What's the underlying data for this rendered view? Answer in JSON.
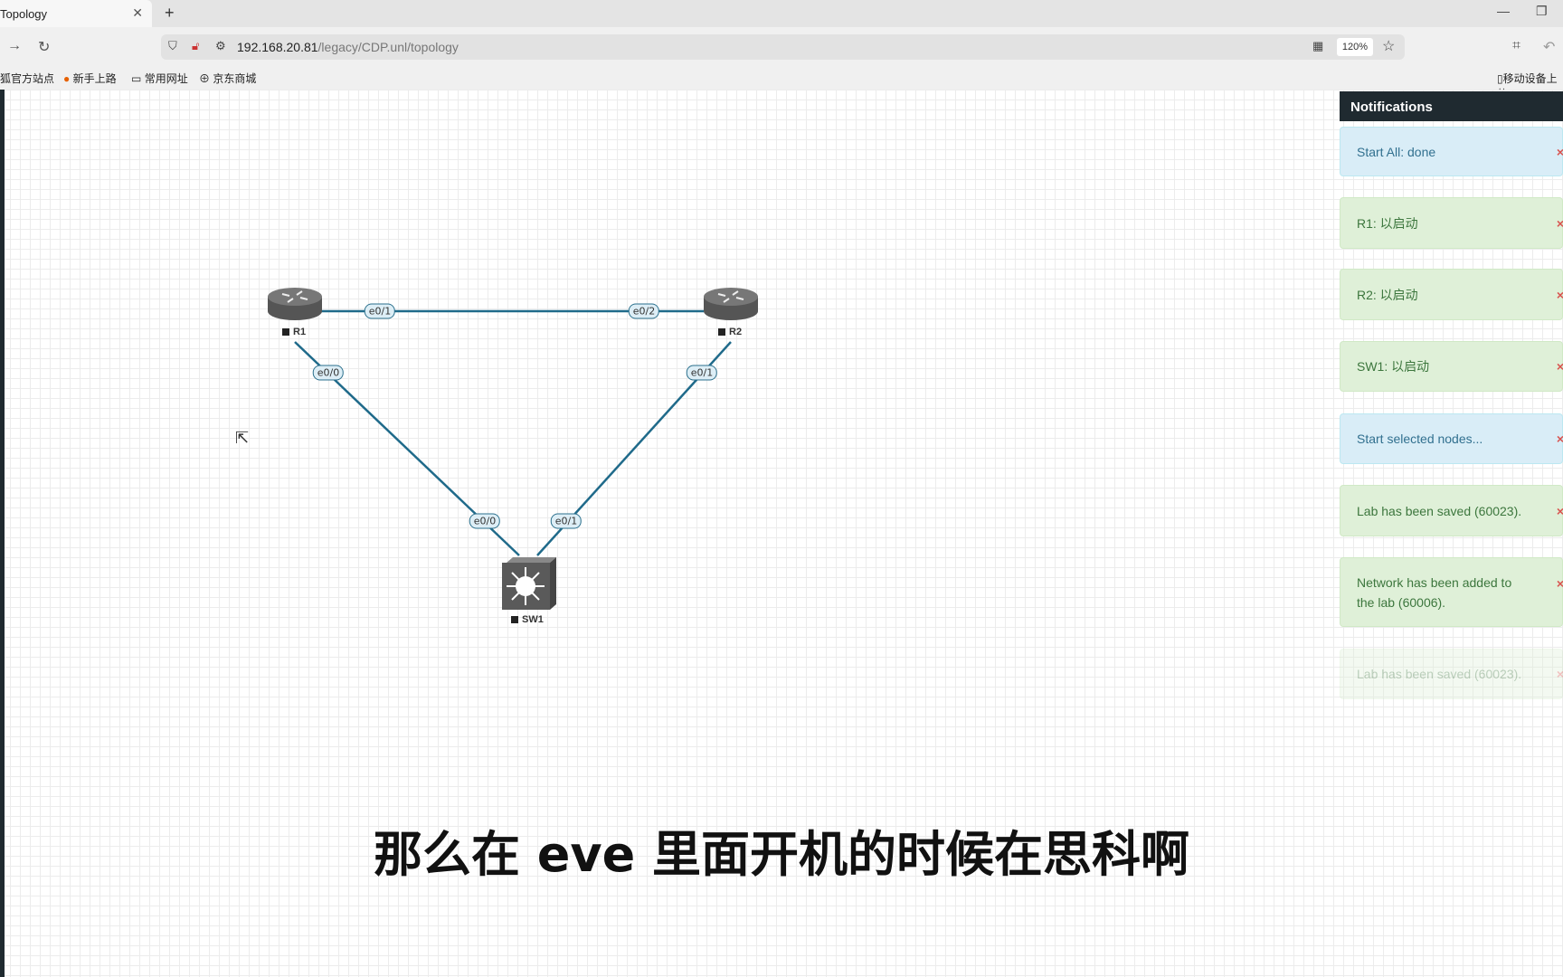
{
  "browser": {
    "tab_title": "Topology",
    "url_host": "192.168.20.81",
    "url_path": "/legacy/CDP.unl/topology",
    "zoom": "120%",
    "bookmarks": [
      "狐官方站点",
      "新手上路",
      "常用网址",
      "京东商城"
    ],
    "mobile_bookmark": "移动设备上的"
  },
  "topology": {
    "nodes": [
      {
        "name": "R1",
        "type": "router"
      },
      {
        "name": "R2",
        "type": "router"
      },
      {
        "name": "SW1",
        "type": "switch"
      }
    ],
    "links": [
      {
        "from": "R1",
        "from_port": "e0/1",
        "to": "R2",
        "to_port": "e0/2"
      },
      {
        "from": "R1",
        "from_port": "e0/0",
        "to": "SW1",
        "to_port": "e0/0"
      },
      {
        "from": "R2",
        "from_port": "e0/1",
        "to": "SW1",
        "to_port": "e0/1"
      }
    ],
    "link_color": "#1f6a8a"
  },
  "notifications": {
    "title": "Notifications",
    "items": [
      {
        "text": "Start All: done",
        "kind": "info"
      },
      {
        "text": "R1: 以启动",
        "kind": "success"
      },
      {
        "text": "R2: 以启动",
        "kind": "success"
      },
      {
        "text": "SW1: 以启动",
        "kind": "success"
      },
      {
        "text": "Start selected nodes...",
        "kind": "info"
      },
      {
        "text": "Lab has been saved (60023).",
        "kind": "success"
      },
      {
        "text": "Network has been added to the lab (60006).",
        "kind": "success"
      },
      {
        "text": "Lab has been saved (60023).",
        "kind": "success-fading"
      }
    ],
    "close_icon": "×"
  },
  "subtitle": "那么在 eve 里面开机的时候在思科啊"
}
